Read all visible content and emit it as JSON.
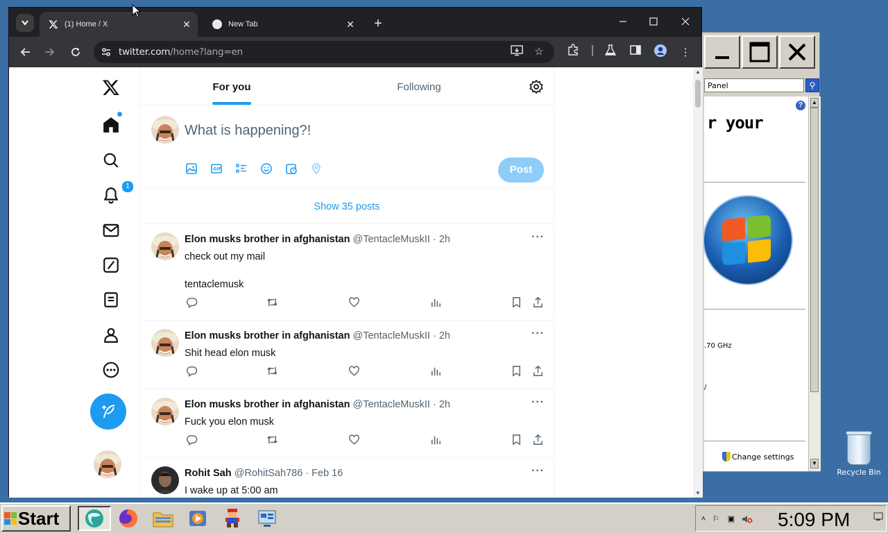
{
  "control_panel": {
    "address": "Panel",
    "heading": "r your",
    "cpu_fragment": ".70 GHz",
    "fragment_y": "/",
    "change_settings": "Change settings"
  },
  "desktop": {
    "recycle_bin_label": "Recycle Bin"
  },
  "browser": {
    "tabs": [
      {
        "title": "(1) Home / X"
      },
      {
        "title": "New Tab"
      }
    ],
    "url_host": "twitter.com",
    "url_path": "/home?lang=en"
  },
  "x": {
    "notifications_count": "1",
    "tabs": {
      "for_you": "For you",
      "following": "Following"
    },
    "composer": {
      "placeholder": "What is happening?!",
      "post_label": "Post"
    },
    "show_posts": "Show 35 posts",
    "more": "···",
    "tweets": [
      {
        "name": "Elon musks brother in afghanistan",
        "handle": "@TentacleMuskII",
        "time": "2h",
        "lines": [
          "check out my mail",
          "",
          "tentaclemusk"
        ]
      },
      {
        "name": "Elon musks brother in afghanistan",
        "handle": "@TentacleMuskII",
        "time": "2h",
        "lines": [
          "Shit head elon musk"
        ]
      },
      {
        "name": "Elon musks brother in afghanistan",
        "handle": "@TentacleMuskII",
        "time": "2h",
        "lines": [
          "Fuck you elon musk"
        ]
      },
      {
        "name": "Rohit Sah",
        "handle": "@RohitSah786",
        "time": "Feb 16",
        "lines": [
          "I wake up at 5:00 am"
        ]
      }
    ]
  },
  "taskbar": {
    "start_label": "Start",
    "clock": "5:09 PM"
  },
  "colors": {
    "accent": "#1d9bf0",
    "desktop": "#3a6ea5"
  }
}
